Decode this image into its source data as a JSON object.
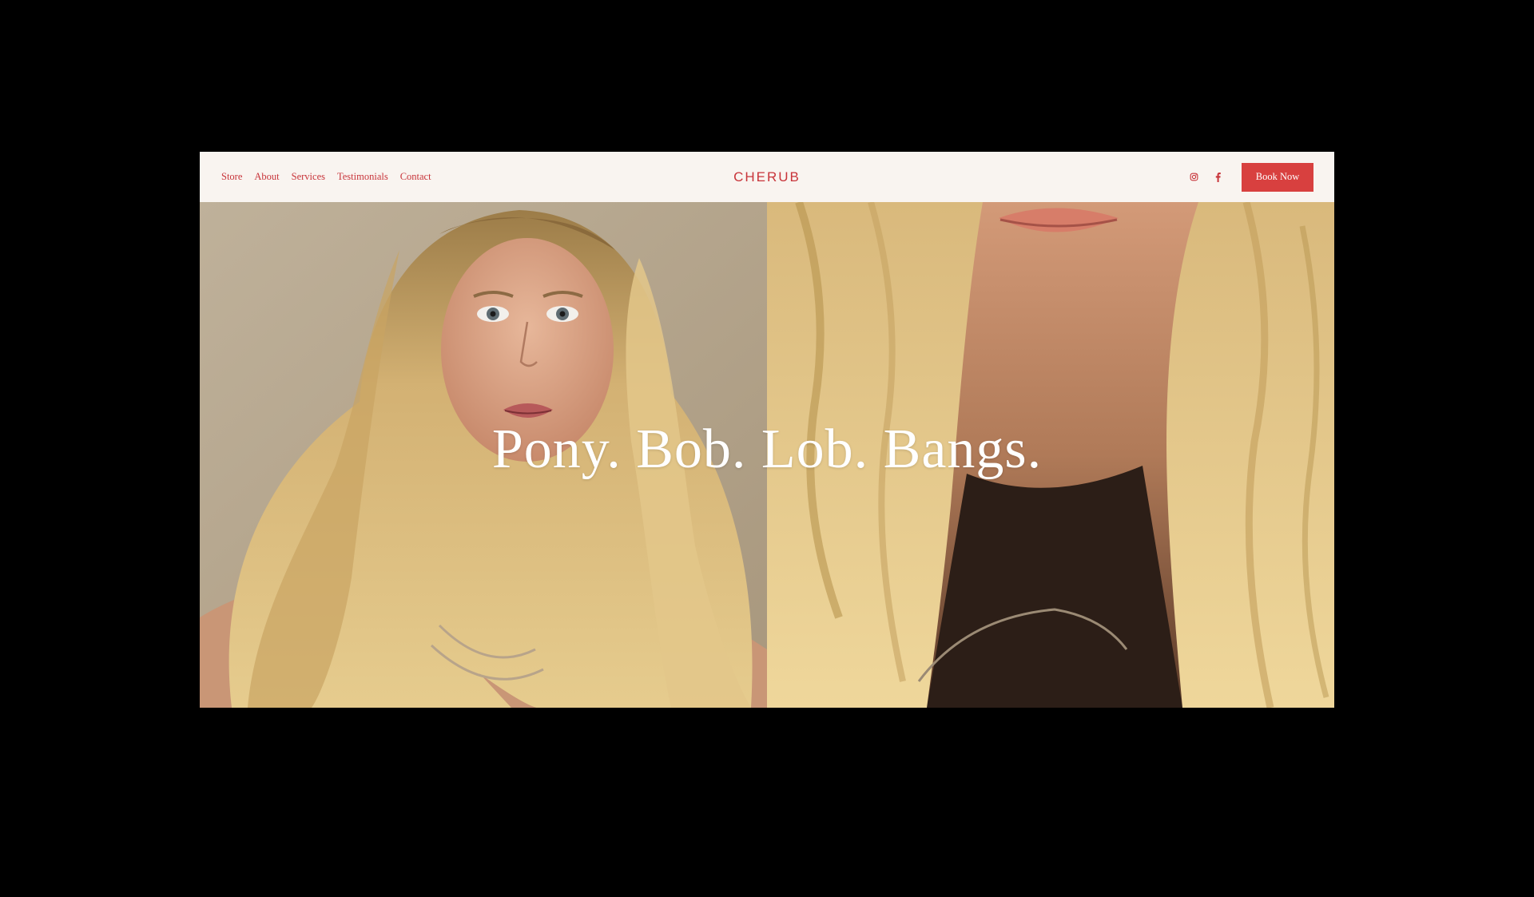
{
  "header": {
    "nav": [
      "Store",
      "About",
      "Services",
      "Testimonials",
      "Contact"
    ],
    "logo": "CHERUB",
    "social": [
      "instagram-icon",
      "facebook-icon"
    ],
    "cta_label": "Book Now"
  },
  "hero": {
    "headline": "Pony. Bob. Lob. Bangs."
  },
  "colors": {
    "brand_red": "#c8343a",
    "button_red": "#d8403f",
    "header_bg": "#f9f4f0",
    "frame_bg": "#000000"
  }
}
